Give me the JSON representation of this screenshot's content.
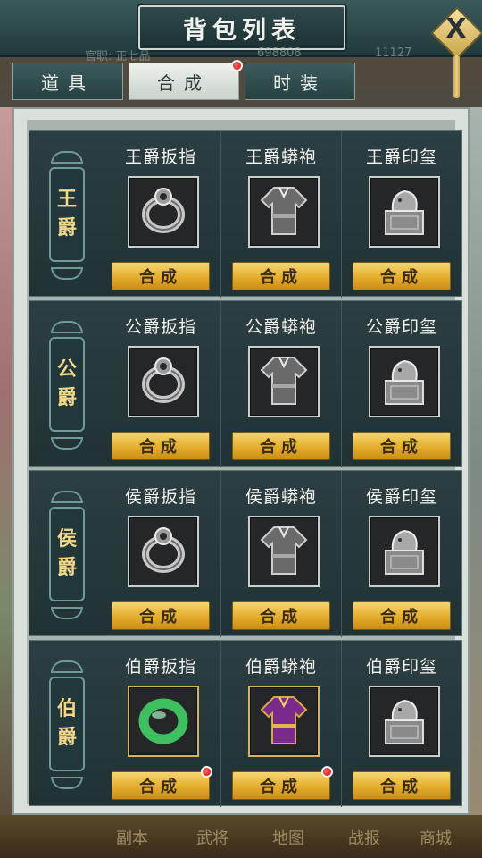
{
  "header": {
    "title": "背包列表",
    "close_label": "X"
  },
  "background_stats": {
    "rank": "官职: 正七品",
    "silver": "698808",
    "gold": "11127"
  },
  "tabs": [
    {
      "label": "道具",
      "active": false,
      "badge": false
    },
    {
      "label": "合成",
      "active": true,
      "badge": true
    },
    {
      "label": "时装",
      "active": false,
      "badge": false
    }
  ],
  "rows": [
    {
      "rank_top": "王",
      "rank_bottom": "爵",
      "items": [
        {
          "name": "王爵扳指",
          "icon": "ring-icon",
          "button": "合成",
          "badge": false,
          "frame": "silver"
        },
        {
          "name": "王爵蟒袍",
          "icon": "robe-icon",
          "button": "合成",
          "badge": false,
          "frame": "silver"
        },
        {
          "name": "王爵印玺",
          "icon": "seal-icon",
          "button": "合成",
          "badge": false,
          "frame": "silver"
        }
      ]
    },
    {
      "rank_top": "公",
      "rank_bottom": "爵",
      "items": [
        {
          "name": "公爵扳指",
          "icon": "ring-icon",
          "button": "合成",
          "badge": false,
          "frame": "silver"
        },
        {
          "name": "公爵蟒袍",
          "icon": "robe-icon",
          "button": "合成",
          "badge": false,
          "frame": "silver"
        },
        {
          "name": "公爵印玺",
          "icon": "seal-icon",
          "button": "合成",
          "badge": false,
          "frame": "silver"
        }
      ]
    },
    {
      "rank_top": "侯",
      "rank_bottom": "爵",
      "items": [
        {
          "name": "侯爵扳指",
          "icon": "ring-icon",
          "button": "合成",
          "badge": false,
          "frame": "silver"
        },
        {
          "name": "侯爵蟒袍",
          "icon": "robe-icon",
          "button": "合成",
          "badge": false,
          "frame": "silver"
        },
        {
          "name": "侯爵印玺",
          "icon": "seal-icon",
          "button": "合成",
          "badge": false,
          "frame": "silver"
        }
      ]
    },
    {
      "rank_top": "伯",
      "rank_bottom": "爵",
      "items": [
        {
          "name": "伯爵扳指",
          "icon": "jade-ring-icon",
          "button": "合成",
          "badge": true,
          "frame": "gold"
        },
        {
          "name": "伯爵蟒袍",
          "icon": "purple-robe-icon",
          "button": "合成",
          "badge": true,
          "frame": "gold"
        },
        {
          "name": "伯爵印玺",
          "icon": "seal-icon",
          "button": "合成",
          "badge": false,
          "frame": "silver"
        }
      ]
    }
  ],
  "bottom_bar": [
    "副本",
    "武将",
    "地图",
    "战报",
    "商城"
  ],
  "colors": {
    "gold_button": "#e2a928",
    "rank_text": "#f2d889",
    "panel_dark": "#213234",
    "badge_red": "#c80000"
  }
}
